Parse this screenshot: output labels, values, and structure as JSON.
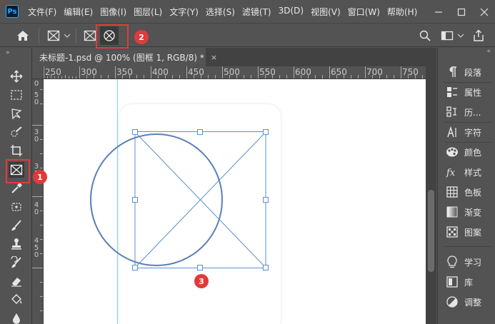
{
  "app": {
    "logo": "Ps"
  },
  "menu": [
    "文件(F)",
    "编辑(E)",
    "图像(I)",
    "图层(L)",
    "文字(Y)",
    "选择(S)",
    "滤镜(T)",
    "3D(D)",
    "视图(V)",
    "窗口(W)",
    "帮助(H)"
  ],
  "window_controls": {
    "minimize_icon": "minimize-icon",
    "maximize_icon": "maximize-icon",
    "close_icon": "close-icon"
  },
  "options_bar": {
    "home_icon": "home-icon",
    "frame_tool_icon": "frame-rect-icon",
    "dropdown_icon": "chevron-down-icon",
    "rect_frame_icon": "frame-rect-icon",
    "ellipse_frame_icon": "frame-ellipse-icon",
    "right_icons": [
      "search-icon",
      "workspace-icon",
      "share-icon"
    ]
  },
  "document_tab": {
    "title": "未标题-1.psd @ 100% (图框 1, RGB/8) *",
    "close": "×"
  },
  "ruler": {
    "horizontal": [
      "250",
      "300",
      "350",
      "400",
      "450",
      "500",
      "550",
      "600",
      "650",
      "700",
      "750"
    ],
    "vertical": [
      "0",
      "5",
      "0",
      "3",
      "0",
      "3",
      "5",
      "0",
      "4",
      "0",
      "4",
      "5",
      "0"
    ]
  },
  "toolbar": [
    "move-icon",
    "marquee-icon",
    "lasso-icon",
    "quick-select-icon",
    "crop-icon",
    "frame-tool-icon",
    "eyedropper-icon",
    "healing-brush-icon",
    "brush-icon",
    "stamp-icon",
    "history-brush-icon",
    "eraser-icon",
    "paint-bucket-icon",
    "blur-icon"
  ],
  "right_panel": [
    {
      "icon": "paragraph-icon",
      "label": "段落"
    },
    {
      "icon": "properties-icon",
      "label": "属性"
    },
    {
      "icon": "history-icon",
      "label": "历..."
    },
    {
      "icon": "character-icon",
      "label": "字符"
    },
    {
      "icon": "color-icon",
      "label": "颜色"
    },
    {
      "icon": "styles-icon",
      "label": "样式"
    },
    {
      "icon": "swatches-icon",
      "label": "色板"
    },
    {
      "icon": "gradient-icon",
      "label": "渐变"
    },
    {
      "icon": "patterns-icon",
      "label": "图案"
    },
    {
      "icon": "learn-icon",
      "label": "学习"
    },
    {
      "icon": "libraries-icon",
      "label": "库"
    },
    {
      "icon": "adjustments-icon",
      "label": "调整"
    }
  ],
  "annotations": {
    "badge1": "1",
    "badge2": "2",
    "badge3": "3"
  },
  "colors": {
    "ui_bg": "#535353",
    "canvas": "#ffffff",
    "frame_line": "#5b7fb5",
    "guide": "#6fe0e0",
    "annotation_red": "#e23a3a"
  }
}
